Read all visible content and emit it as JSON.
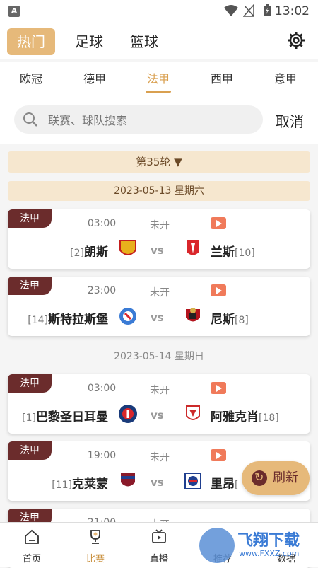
{
  "status": {
    "time": "13:02",
    "a_icon": "A"
  },
  "top_tabs": [
    {
      "label": "热门",
      "active": true
    },
    {
      "label": "足球",
      "active": false
    },
    {
      "label": "篮球",
      "active": false
    }
  ],
  "league_tabs": [
    {
      "label": "欧冠",
      "active": false
    },
    {
      "label": "德甲",
      "active": false
    },
    {
      "label": "法甲",
      "active": true
    },
    {
      "label": "西甲",
      "active": false
    },
    {
      "label": "意甲",
      "active": false
    }
  ],
  "search": {
    "placeholder": "联赛、球队搜索",
    "cancel": "取消"
  },
  "round": {
    "label": "第35轮 ▼"
  },
  "dates": [
    "2023-05-13 星期六",
    "2023-05-14 星期日"
  ],
  "matches": [
    {
      "league": "法甲",
      "time": "03:00",
      "status": "未开",
      "home": "朗斯",
      "home_rank": "[2]",
      "away": "兰斯",
      "away_rank": "[10]",
      "vs": "vs",
      "home_color": "#e8b01c",
      "away_color": "#d9262b"
    },
    {
      "league": "法甲",
      "time": "23:00",
      "status": "未开",
      "home": "斯特拉斯堡",
      "home_rank": "[14]",
      "away": "尼斯",
      "away_rank": "[8]",
      "vs": "vs",
      "home_color": "#3a7bd5",
      "away_color": "#b3141d"
    },
    {
      "league": "法甲",
      "time": "03:00",
      "status": "未开",
      "home": "巴黎圣日耳曼",
      "home_rank": "[1]",
      "away": "阿雅克肖",
      "away_rank": "[18]",
      "vs": "vs",
      "home_color": "#1a3b7a",
      "away_color": "#cc2a2a"
    },
    {
      "league": "法甲",
      "time": "19:00",
      "status": "未开",
      "home": "克莱蒙",
      "home_rank": "[11]",
      "away": "里昂",
      "away_rank": "[",
      "vs": "vs",
      "home_color": "#8a1a2a",
      "away_color": "#1f3f8f"
    },
    {
      "league": "法甲",
      "time": "21:00",
      "status": "未开"
    }
  ],
  "refresh": {
    "label": "刷新"
  },
  "bottom_nav": [
    {
      "label": "首页",
      "icon": "home-icon",
      "active": false
    },
    {
      "label": "比赛",
      "icon": "trophy-icon",
      "active": true
    },
    {
      "label": "直播",
      "icon": "tv-icon",
      "active": false
    },
    {
      "label": "推荐",
      "icon": "recommend-icon",
      "active": false
    },
    {
      "label": "数据",
      "icon": "data-icon",
      "active": false
    }
  ],
  "watermark": {
    "text": "飞翔下载",
    "url": "www.FXXZ.com"
  },
  "colors": {
    "accent": "#e6b97a",
    "league_badge": "#6b2c2c",
    "active_text": "#d9a050"
  }
}
